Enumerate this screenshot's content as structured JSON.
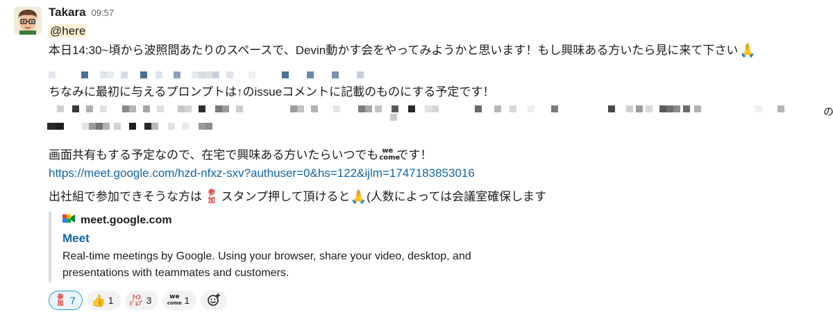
{
  "message": {
    "author": "Takara",
    "time": "09:57",
    "mention": "@here",
    "line1": "本日14:30~頃から波照間あたりのスペースで、Devin動かす会をやってみようかと思います！もし興味ある方いたら見に来て下さい",
    "line2": "ちなみに最初に与えるプロンプトは↑のissueコメントに記載のものにする予定です！",
    "line2b": "の",
    "line3a": "画面共有もする予定なので、在宅で興味ある方いたらいつでも",
    "line3b": "です！",
    "link": "https://meet.google.com/hzd-nfxz-sxv?authuser=0&hs=122&ijlm=1747183853016",
    "line4a": "出社組で参加できそうな方は",
    "line4b": "スタンプ押して頂けると",
    "line4c": "(人数によっては会議室確保します"
  },
  "emoji": {
    "welcome_text": [
      "we",
      "come"
    ],
    "sanka_text": [
      "参",
      "加"
    ]
  },
  "unfurl": {
    "site": "meet.google.com",
    "title": "Meet",
    "description_line1": "Real-time meetings by Google. Using your browser, share your video, desktop, and",
    "description_line2": "presentations with teammates and customers."
  },
  "reactions": [
    {
      "name": "sanka",
      "label": "参加",
      "count": "7",
      "active": true
    },
    {
      "name": "thumbsup",
      "label": "👍",
      "count": "1",
      "active": false
    },
    {
      "name": "nice-joke",
      "label": "ナイス ジョブ",
      "count": "3",
      "active": false
    },
    {
      "name": "welcome",
      "label": "welcome",
      "count": "1",
      "active": false
    }
  ],
  "colors": {
    "link": "#1264a3",
    "mention_bg": "#fdf0d2",
    "reaction_active_border": "#1d9bd1"
  }
}
